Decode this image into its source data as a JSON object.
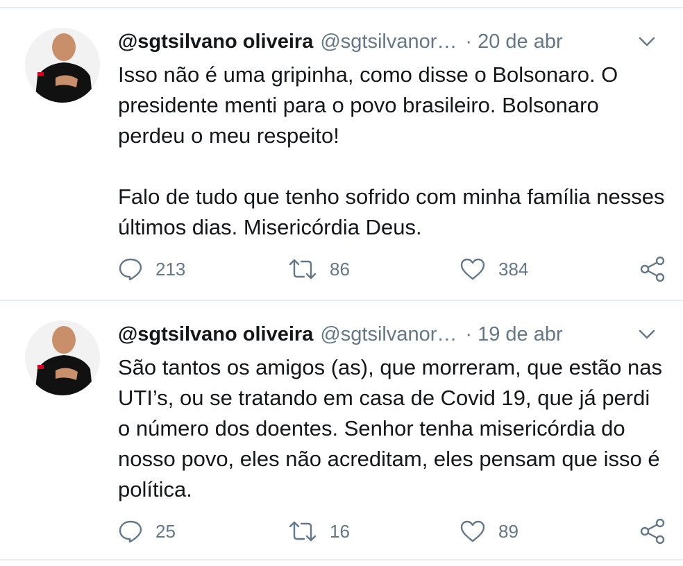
{
  "tweets": [
    {
      "author_name": "@sgtsilvano oliveira",
      "handle": "@sgtsilvanor…",
      "separator": "·",
      "date": "20 de abr",
      "paragraphs": [
        "Isso não é uma gripinha, como disse o Bolsonaro. O presidente menti para o povo brasileiro. Bolsonaro perdeu o meu respeito!",
        "Falo de tudo que tenho sofrido com minha família nesses últimos dias. Misericórdia Deus."
      ],
      "replies": "213",
      "retweets": "86",
      "likes": "384"
    },
    {
      "author_name": "@sgtsilvano oliveira",
      "handle": "@sgtsilvanor…",
      "separator": "·",
      "date": "19 de abr",
      "paragraphs": [
        "São tantos os amigos (as), que morreram, que estão nas UTI’s, ou se tratando em casa de Covid 19, que já perdi o número dos doentes. Senhor tenha misericórdia do nosso povo, eles não acreditam, eles pensam que isso é política."
      ],
      "replies": "25",
      "retweets": "16",
      "likes": "89"
    }
  ],
  "icons": {
    "reply": "speech-bubble-icon",
    "retweet": "retweet-arrows-icon",
    "like": "heart-icon",
    "share": "share-icon",
    "menu": "chevron-down-icon"
  },
  "colors": {
    "text": "#14171a",
    "secondary": "#657786",
    "divider": "#e6ecf0"
  }
}
